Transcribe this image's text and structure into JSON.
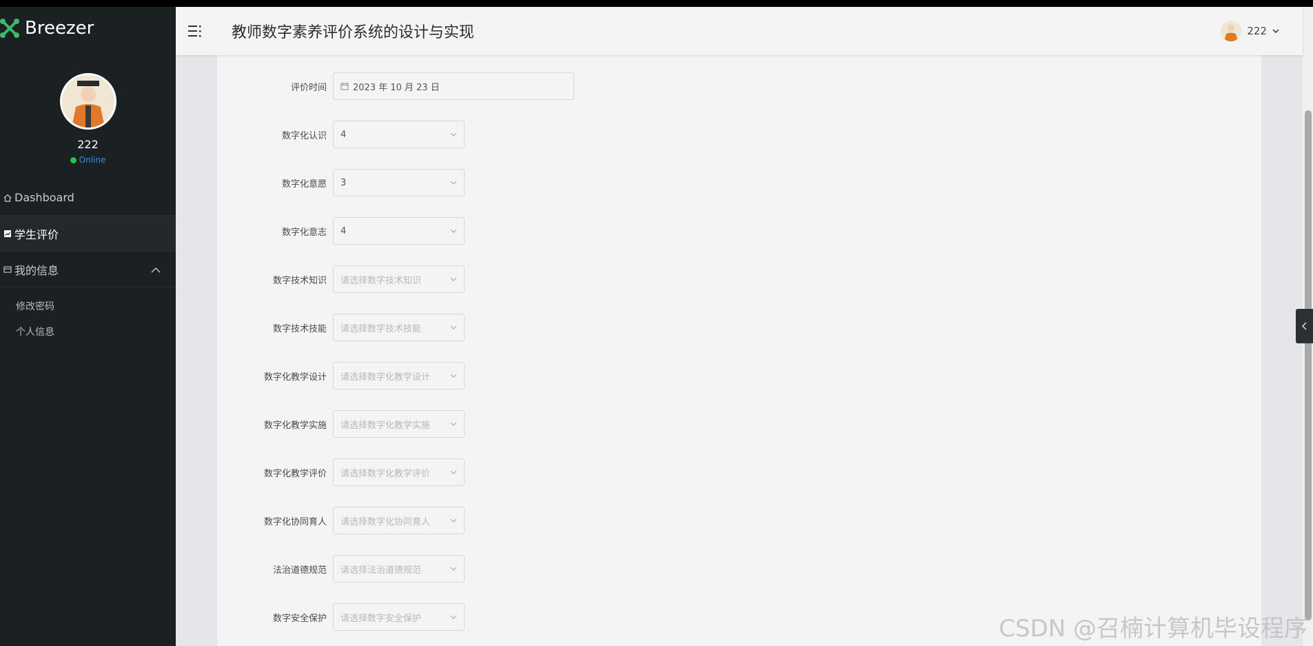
{
  "brand": {
    "name": "Breezer"
  },
  "profile": {
    "name": "222",
    "status": "Online"
  },
  "nav": {
    "dashboard": "Dashboard",
    "student_eval": "学生评价",
    "my_info": "我的信息",
    "change_password": "修改密码",
    "personal_info": "个人信息"
  },
  "header": {
    "title": "教师数字素养评价系统的设计与实现",
    "user": "222"
  },
  "form": {
    "date": {
      "label": "评价时间",
      "value": "2023 年 10 月 23 日"
    },
    "fields": [
      {
        "label": "数字化认识",
        "value": "4",
        "placeholder": ""
      },
      {
        "label": "数字化意愿",
        "value": "3",
        "placeholder": ""
      },
      {
        "label": "数字化意志",
        "value": "4",
        "placeholder": ""
      },
      {
        "label": "数字技术知识",
        "value": "",
        "placeholder": "请选择数字技术知识"
      },
      {
        "label": "数字技术技能",
        "value": "",
        "placeholder": "请选择数字技术技能"
      },
      {
        "label": "数字化教学设计",
        "value": "",
        "placeholder": "请选择数字化教学设计"
      },
      {
        "label": "数字化教学实施",
        "value": "",
        "placeholder": "请选择数字化教学实施"
      },
      {
        "label": "数字化教学评价",
        "value": "",
        "placeholder": "请选择数字化教学评价"
      },
      {
        "label": "数字化协同育人",
        "value": "",
        "placeholder": "请选择数字化协同育人"
      },
      {
        "label": "法治道德规范",
        "value": "",
        "placeholder": "请选择法治道德规范"
      },
      {
        "label": "数字安全保护",
        "value": "",
        "placeholder": "请选择数字安全保护"
      }
    ]
  },
  "watermark": "CSDN @召楠计算机毕设程序",
  "colors": {
    "sidebar": "#1b2023",
    "online": "#27c24c",
    "accent": "#3a8dde"
  }
}
